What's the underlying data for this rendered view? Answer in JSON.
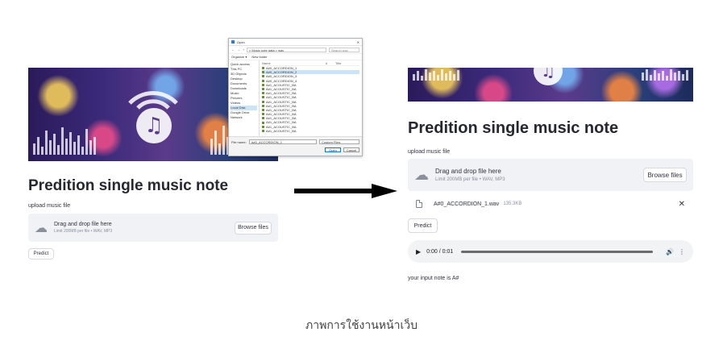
{
  "left_app": {
    "title": "Predition single music note",
    "upload_label": "upload music file",
    "drop_main": "Drag and drop file here",
    "drop_sub": "Limit 200MB per file • WAV, MP3",
    "browse_label": "Browse files",
    "predict_label": "Predict",
    "icons": {
      "banner_icon": "music-note-icon",
      "wifi": "wifi-icon",
      "cloud": "cloud-upload-icon"
    }
  },
  "file_dialog": {
    "title": "Open",
    "address": "« Music note data > wav",
    "search_placeholder": "Search wav",
    "organize": "Organize ▾",
    "new_folder": "New folder",
    "nav_items": [
      "Quick access",
      "This PC",
      "3D Objects",
      "Desktop",
      "Documents",
      "Downloads",
      "Music",
      "Pictures",
      "Videos",
      "Local Disk",
      "Google Drive",
      "Network"
    ],
    "col_name": "Name",
    "col_num": "#",
    "col_title": "Title",
    "files": [
      "A#0_ACCORDION_1",
      "A#0_ACCORDION_2",
      "A#0_ACCORDION_3",
      "A#0_ACCORDION_4",
      "A#1_ACOUSTIC_BA",
      "A#1_ACOUSTIC_BA",
      "A#1_ACOUSTIC_BA",
      "A#1_ACOUSTIC_BA",
      "A#1_ACOUSTIC_BA",
      "A#1_ACOUSTIC_BA",
      "A#1_ACOUSTIC_BA",
      "A#1_ACOUSTIC_BA",
      "A#1_ACOUSTIC_BA",
      "A#1_ACOUSTIC_BA",
      "A#1_ACOUSTIC_BA",
      "A#1_ACOUSTIC_BA"
    ],
    "selected_file_index": 1,
    "filename_label": "File name:",
    "filename_value": "A#0_ACCORDION_1",
    "filetype_value": "Custom Files",
    "open_label": "Open",
    "cancel_label": "Cancel"
  },
  "right_app": {
    "title": "Predition single music note",
    "upload_label": "upload music file",
    "drop_main": "Drag and drop file here",
    "drop_sub": "Limit 200MB per file • WAV, MP3",
    "browse_label": "Browse files",
    "file_name": "A#0_ACCORDION_1.wav",
    "file_size": "135.3KB",
    "close_glyph": "✕",
    "predict_label": "Predict",
    "audio_time": "0:00 / 0:01",
    "result": "your input note is A#"
  },
  "caption": "ภาพการใช้งานหน้าเว็บ"
}
